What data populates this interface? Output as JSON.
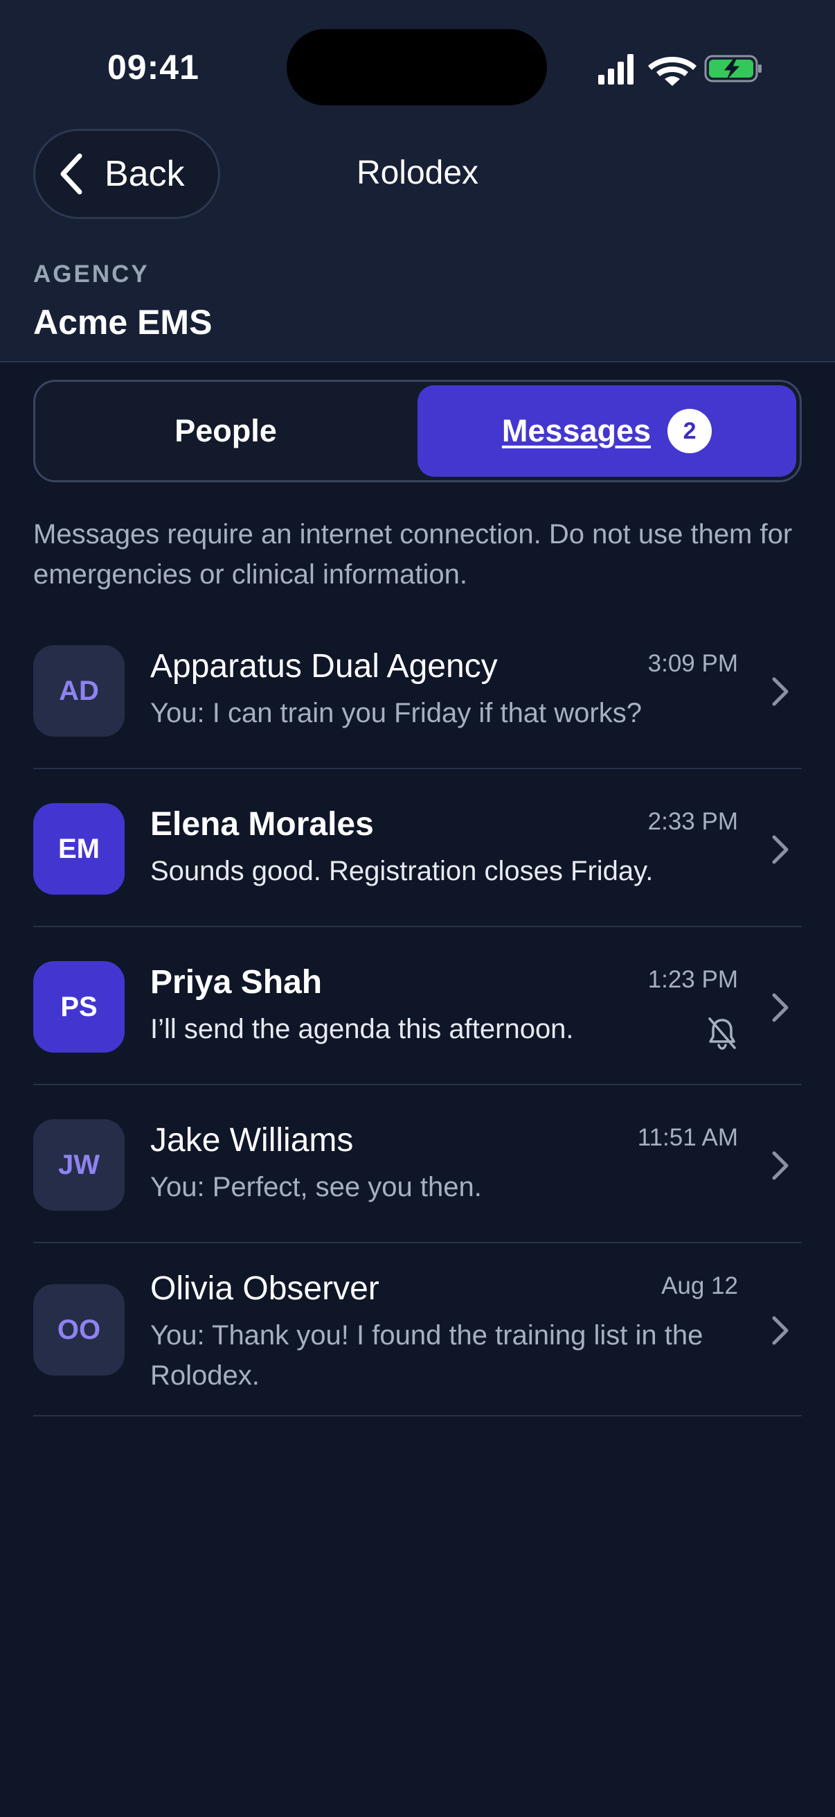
{
  "status_bar": {
    "time": "09:41"
  },
  "nav": {
    "back_label": "Back",
    "title": "Rolodex"
  },
  "agency": {
    "caption": "AGENCY",
    "name": "Acme EMS"
  },
  "tabs": {
    "people_label": "People",
    "messages_label": "Messages",
    "messages_badge": "2"
  },
  "notice": "Messages require an internet connection. Do not use them for emergencies or clinical information.",
  "conversations": [
    {
      "initials": "AD",
      "name": "Apparatus Dual Agency",
      "preview": "You: I can train you Friday if that works?",
      "time": "3:09 PM",
      "unread": false,
      "muted": false
    },
    {
      "initials": "EM",
      "name": "Elena Morales",
      "preview": "Sounds good. Registration closes Friday.",
      "time": "2:33 PM",
      "unread": true,
      "muted": false
    },
    {
      "initials": "PS",
      "name": "Priya Shah",
      "preview": "I’ll send the agenda this afternoon.",
      "time": "1:23 PM",
      "unread": true,
      "muted": true
    },
    {
      "initials": "JW",
      "name": "Jake Williams",
      "preview": "You: Perfect, see you then.",
      "time": "11:51 AM",
      "unread": false,
      "muted": false
    },
    {
      "initials": "OO",
      "name": "Olivia Observer",
      "preview": "You: Thank you! I found the training list in the Rolodex.",
      "time": "Aug 12",
      "unread": false,
      "muted": false
    }
  ],
  "icons": {
    "back": "chevron-left-icon",
    "row": "chevron-right-icon",
    "muted": "bell-slash-icon",
    "signal": "cellular-signal-icon",
    "wifi": "wifi-icon",
    "battery": "battery-charging-icon"
  },
  "colors": {
    "background": "#0f1628",
    "header": "#172035",
    "accent": "#4437d0",
    "battery": "#34c759"
  }
}
